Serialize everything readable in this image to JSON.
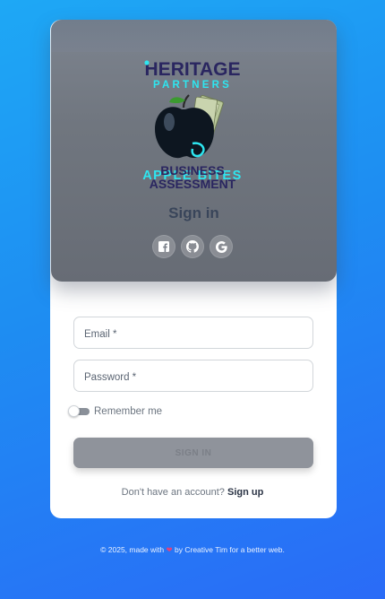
{
  "logo": {
    "line1": "HERITAGE",
    "line2": "PARTNERS",
    "line3": "APPLE BITES",
    "line4": "BUSINESS",
    "line5": "ASSESSMENT"
  },
  "header": {
    "title": "Sign in",
    "social": [
      "facebook-icon",
      "github-icon",
      "google-icon"
    ]
  },
  "form": {
    "email_label": "Email *",
    "password_label": "Password *",
    "remember_label": "Remember me",
    "remember_checked": false,
    "submit_label": "SIGN IN"
  },
  "signup": {
    "prompt": "Don't have an account?",
    "link": "Sign up"
  },
  "footer": {
    "prefix": "© 2025, made with",
    "heart": "❤",
    "suffix": "by Creative Tim for a better web."
  },
  "colors": {
    "background_start": "#1ea8f5",
    "background_end": "#2a6bf7",
    "header_gray": "#70767f",
    "logo_navy": "#2a2660",
    "logo_cyan": "#2ee6f0"
  }
}
